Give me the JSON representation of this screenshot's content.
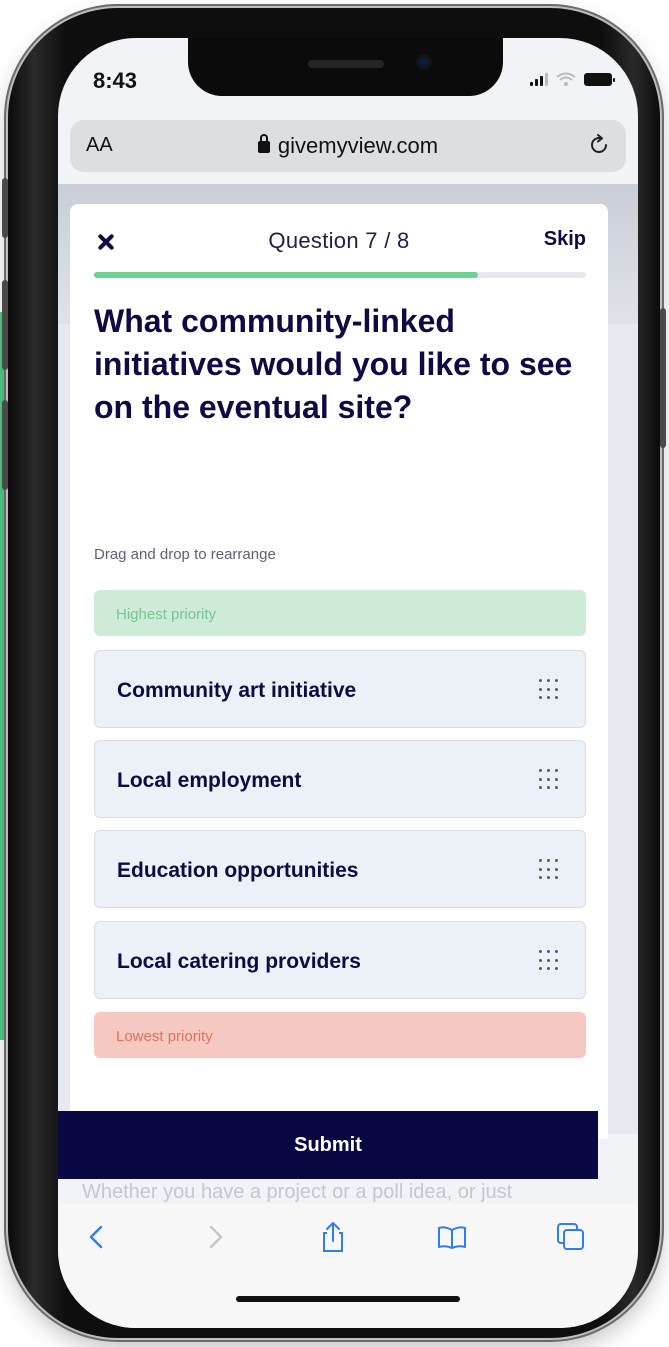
{
  "colors": {
    "brand_navy": "#0e0a44",
    "progress_green": "#6fcf95",
    "highest_bg": "#cdebd6",
    "lowest_bg": "#f5c8c1",
    "item_bg": "#ecf0f7"
  },
  "status_bar": {
    "time": "8:43"
  },
  "browser": {
    "text_size_label": "AA",
    "url": "givemyview.com",
    "icons": [
      "lock-icon",
      "reload-icon",
      "back-icon",
      "forward-icon",
      "share-icon",
      "bookmarks-icon",
      "tabs-icon"
    ]
  },
  "question": {
    "counter": "Question 7 / 8",
    "skip_label": "Skip",
    "progress": 0.78,
    "title": "What community-linked initiatives would you like to see on the eventual site?",
    "hint": "Drag and drop to rearrange",
    "highest_label": "Highest priority",
    "lowest_label": "Lowest priority",
    "items": [
      {
        "label": "Community art initiative"
      },
      {
        "label": "Local employment"
      },
      {
        "label": "Education opportunities"
      },
      {
        "label": "Local catering providers"
      }
    ],
    "submit_label": "Submit"
  },
  "background_text": "Whether you have a project or a poll idea, or just"
}
